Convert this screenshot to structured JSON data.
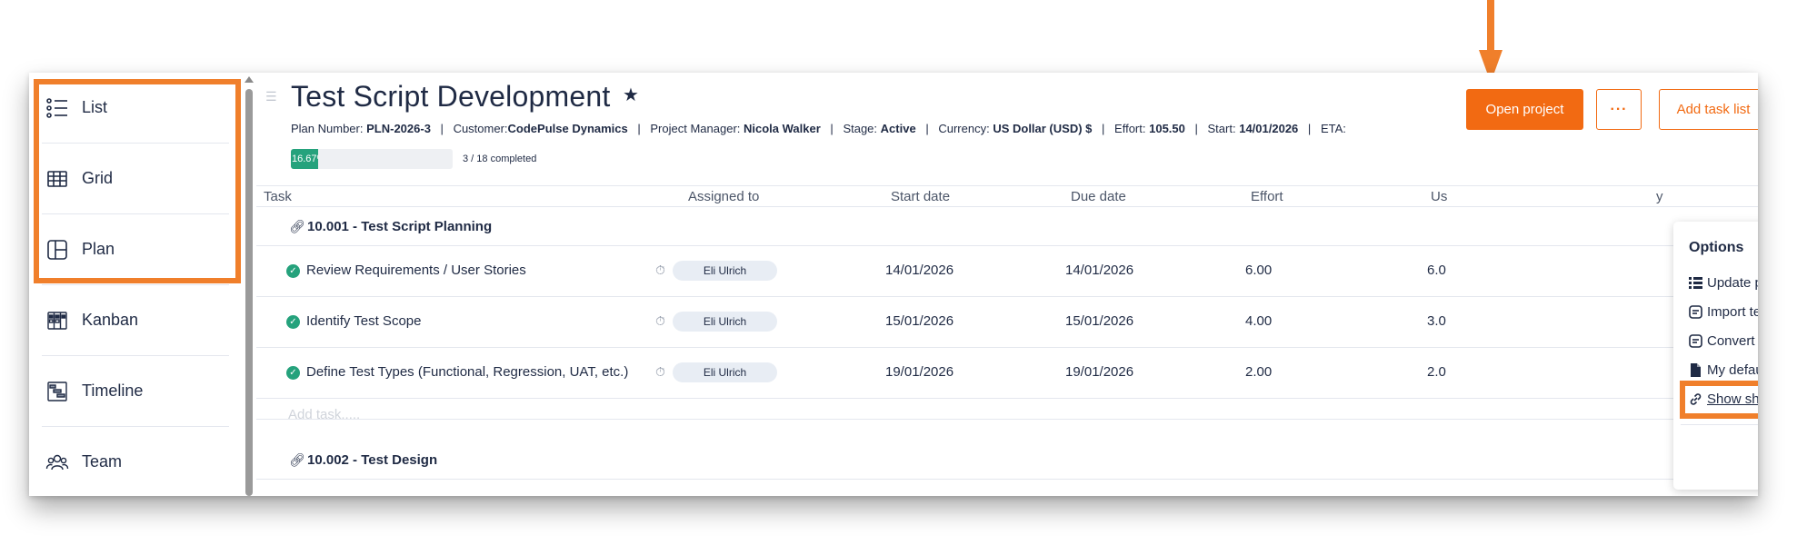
{
  "sidebar": {
    "items": [
      {
        "label": "List",
        "icon": "list-icon"
      },
      {
        "label": "Grid",
        "icon": "table-grid-icon"
      },
      {
        "label": "Plan",
        "icon": "plan-layout-icon"
      },
      {
        "label": "Kanban",
        "icon": "kanban-icon"
      },
      {
        "label": "Timeline",
        "icon": "timeline-icon"
      },
      {
        "label": "Team",
        "icon": "team-icon"
      }
    ]
  },
  "project": {
    "title": "Test Script Development",
    "star": "★",
    "meta": {
      "plan_number_label": "Plan Number:",
      "plan_number": "PLN-2026-3",
      "customer_label": "Customer:",
      "customer": "CodePulse Dynamics",
      "pm_label": "Project Manager:",
      "pm": "Nicola Walker",
      "stage_label": "Stage:",
      "stage": "Active",
      "currency_label": "Currency:",
      "currency": "US Dollar (USD) $",
      "effort_label": "Effort:",
      "effort": "105.50",
      "start_label": "Start:",
      "start": "14/01/2026",
      "eta_label": "ETA:",
      "separator": "|"
    },
    "progress": {
      "percent_text": "16.67%",
      "fraction": 0.1667,
      "completed_text": "3 / 18 completed"
    }
  },
  "toolbar": {
    "open_project": "Open project",
    "more": "···",
    "add_task_list": "Add task list"
  },
  "table": {
    "columns": [
      "Task",
      "Assigned to",
      "Start date",
      "Due date",
      "Effort",
      "Us",
      "y"
    ],
    "groups": [
      {
        "name": "10.001 - Test Script Planning",
        "tasks": [
          {
            "name": "Review Requirements / User Stories",
            "assignee": "Eli Ulrich",
            "start": "14/01/2026",
            "due": "14/01/2026",
            "effort": "6.00",
            "used": "6.0"
          },
          {
            "name": "Identify Test Scope",
            "assignee": "Eli Ulrich",
            "start": "15/01/2026",
            "due": "15/01/2026",
            "effort": "4.00",
            "used": "3.0"
          },
          {
            "name": "Define Test Types (Functional, Regression, UAT, etc.)",
            "assignee": "Eli Ulrich",
            "start": "19/01/2026",
            "due": "19/01/2026",
            "effort": "2.00",
            "used": "2.0"
          }
        ],
        "add_task_placeholder": "Add task....."
      },
      {
        "name": "10.002 - Test Design",
        "tasks": []
      }
    ]
  },
  "menu": {
    "title": "Options",
    "items": [
      {
        "label": "Update planning",
        "icon": "list-bullets-icon"
      },
      {
        "label": "Import template",
        "icon": "template-icon"
      },
      {
        "label": "Convert to template",
        "icon": "template-icon"
      },
      {
        "label": "My default plan view",
        "icon": "document-icon"
      },
      {
        "label": "Show shareable link",
        "icon": "link-icon"
      }
    ]
  },
  "colors": {
    "accent": "#f26a12",
    "annotation": "#f07f2b",
    "success": "#25a27c",
    "text": "#1f2a44"
  }
}
